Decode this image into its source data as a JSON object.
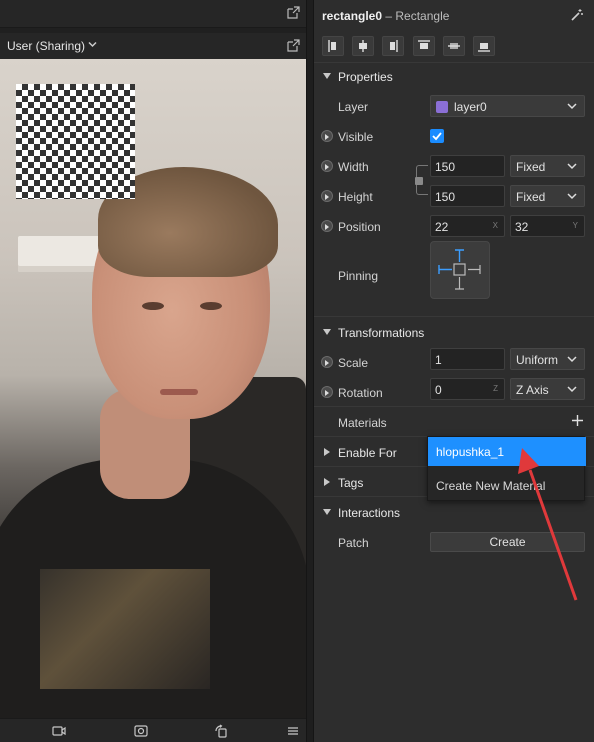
{
  "viewport": {
    "view_title": "User (Sharing)"
  },
  "inspector": {
    "object_name": "rectangle0",
    "object_type": "– Rectangle",
    "properties": {
      "section_label": "Properties",
      "layer_label": "Layer",
      "layer_value": "layer0",
      "layer_color": "#8b6fd6",
      "visible_label": "Visible",
      "visible_checked": true,
      "width_label": "Width",
      "width_value": "150",
      "width_mode": "Fixed",
      "height_label": "Height",
      "height_value": "150",
      "height_mode": "Fixed",
      "position_label": "Position",
      "position_x": "22",
      "position_x_axis": "X",
      "position_y": "32",
      "position_y_axis": "Y",
      "pinning_label": "Pinning"
    },
    "transformations": {
      "section_label": "Transformations",
      "scale_label": "Scale",
      "scale_value": "1",
      "scale_mode": "Uniform",
      "rotation_label": "Rotation",
      "rotation_value": "0",
      "rotation_axis_hint": "Z",
      "rotation_axis": "Z Axis"
    },
    "materials_label": "Materials",
    "enable_for_label": "Enable For",
    "tags_label": "Tags",
    "interactions": {
      "section_label": "Interactions",
      "patch_label": "Patch",
      "create_label": "Create"
    }
  },
  "materials_dropdown": {
    "options": [
      "hlopushka_1",
      "Create New Material"
    ],
    "highlight_color": "#1e90ff"
  },
  "accent_color": "#1a8cff",
  "annotation_color": "#e0393b"
}
